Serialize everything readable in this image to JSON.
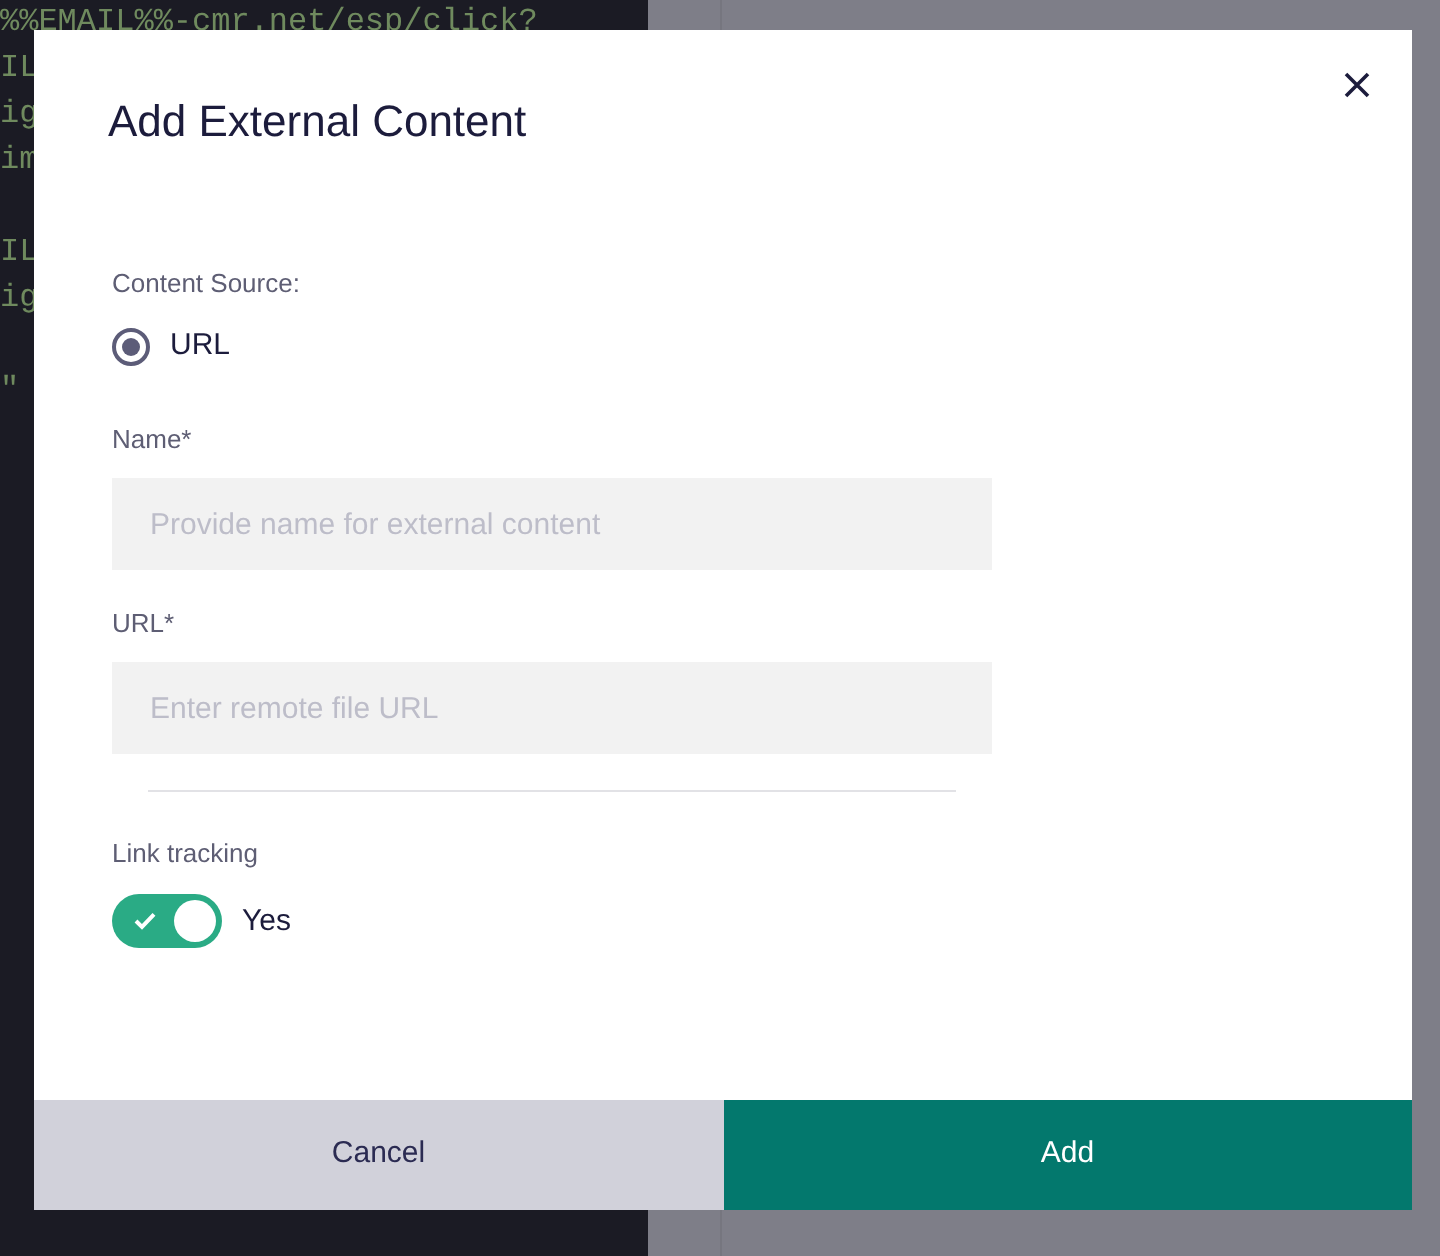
{
  "background": {
    "code_blocks": [
      [
        "%%EMAIL%%-cmr.net/esp/click?",
        "IL",
        "ig",
        "im"
      ],
      [
        "IL",
        "ig"
      ],
      [
        "\""
      ]
    ]
  },
  "dialog": {
    "title": "Add External Content",
    "content_source": {
      "label": "Content Source:",
      "options": [
        {
          "label": "URL",
          "selected": true
        }
      ]
    },
    "fields": [
      {
        "label": "Name*",
        "placeholder": "Provide name for external content"
      },
      {
        "label": "URL*",
        "placeholder": "Enter remote file URL"
      }
    ],
    "link_tracking": {
      "label": "Link tracking",
      "on": true,
      "value": "Yes"
    },
    "buttons": [
      {
        "label": "Cancel",
        "kind": "secondary"
      },
      {
        "label": "Add",
        "kind": "primary"
      }
    ]
  }
}
